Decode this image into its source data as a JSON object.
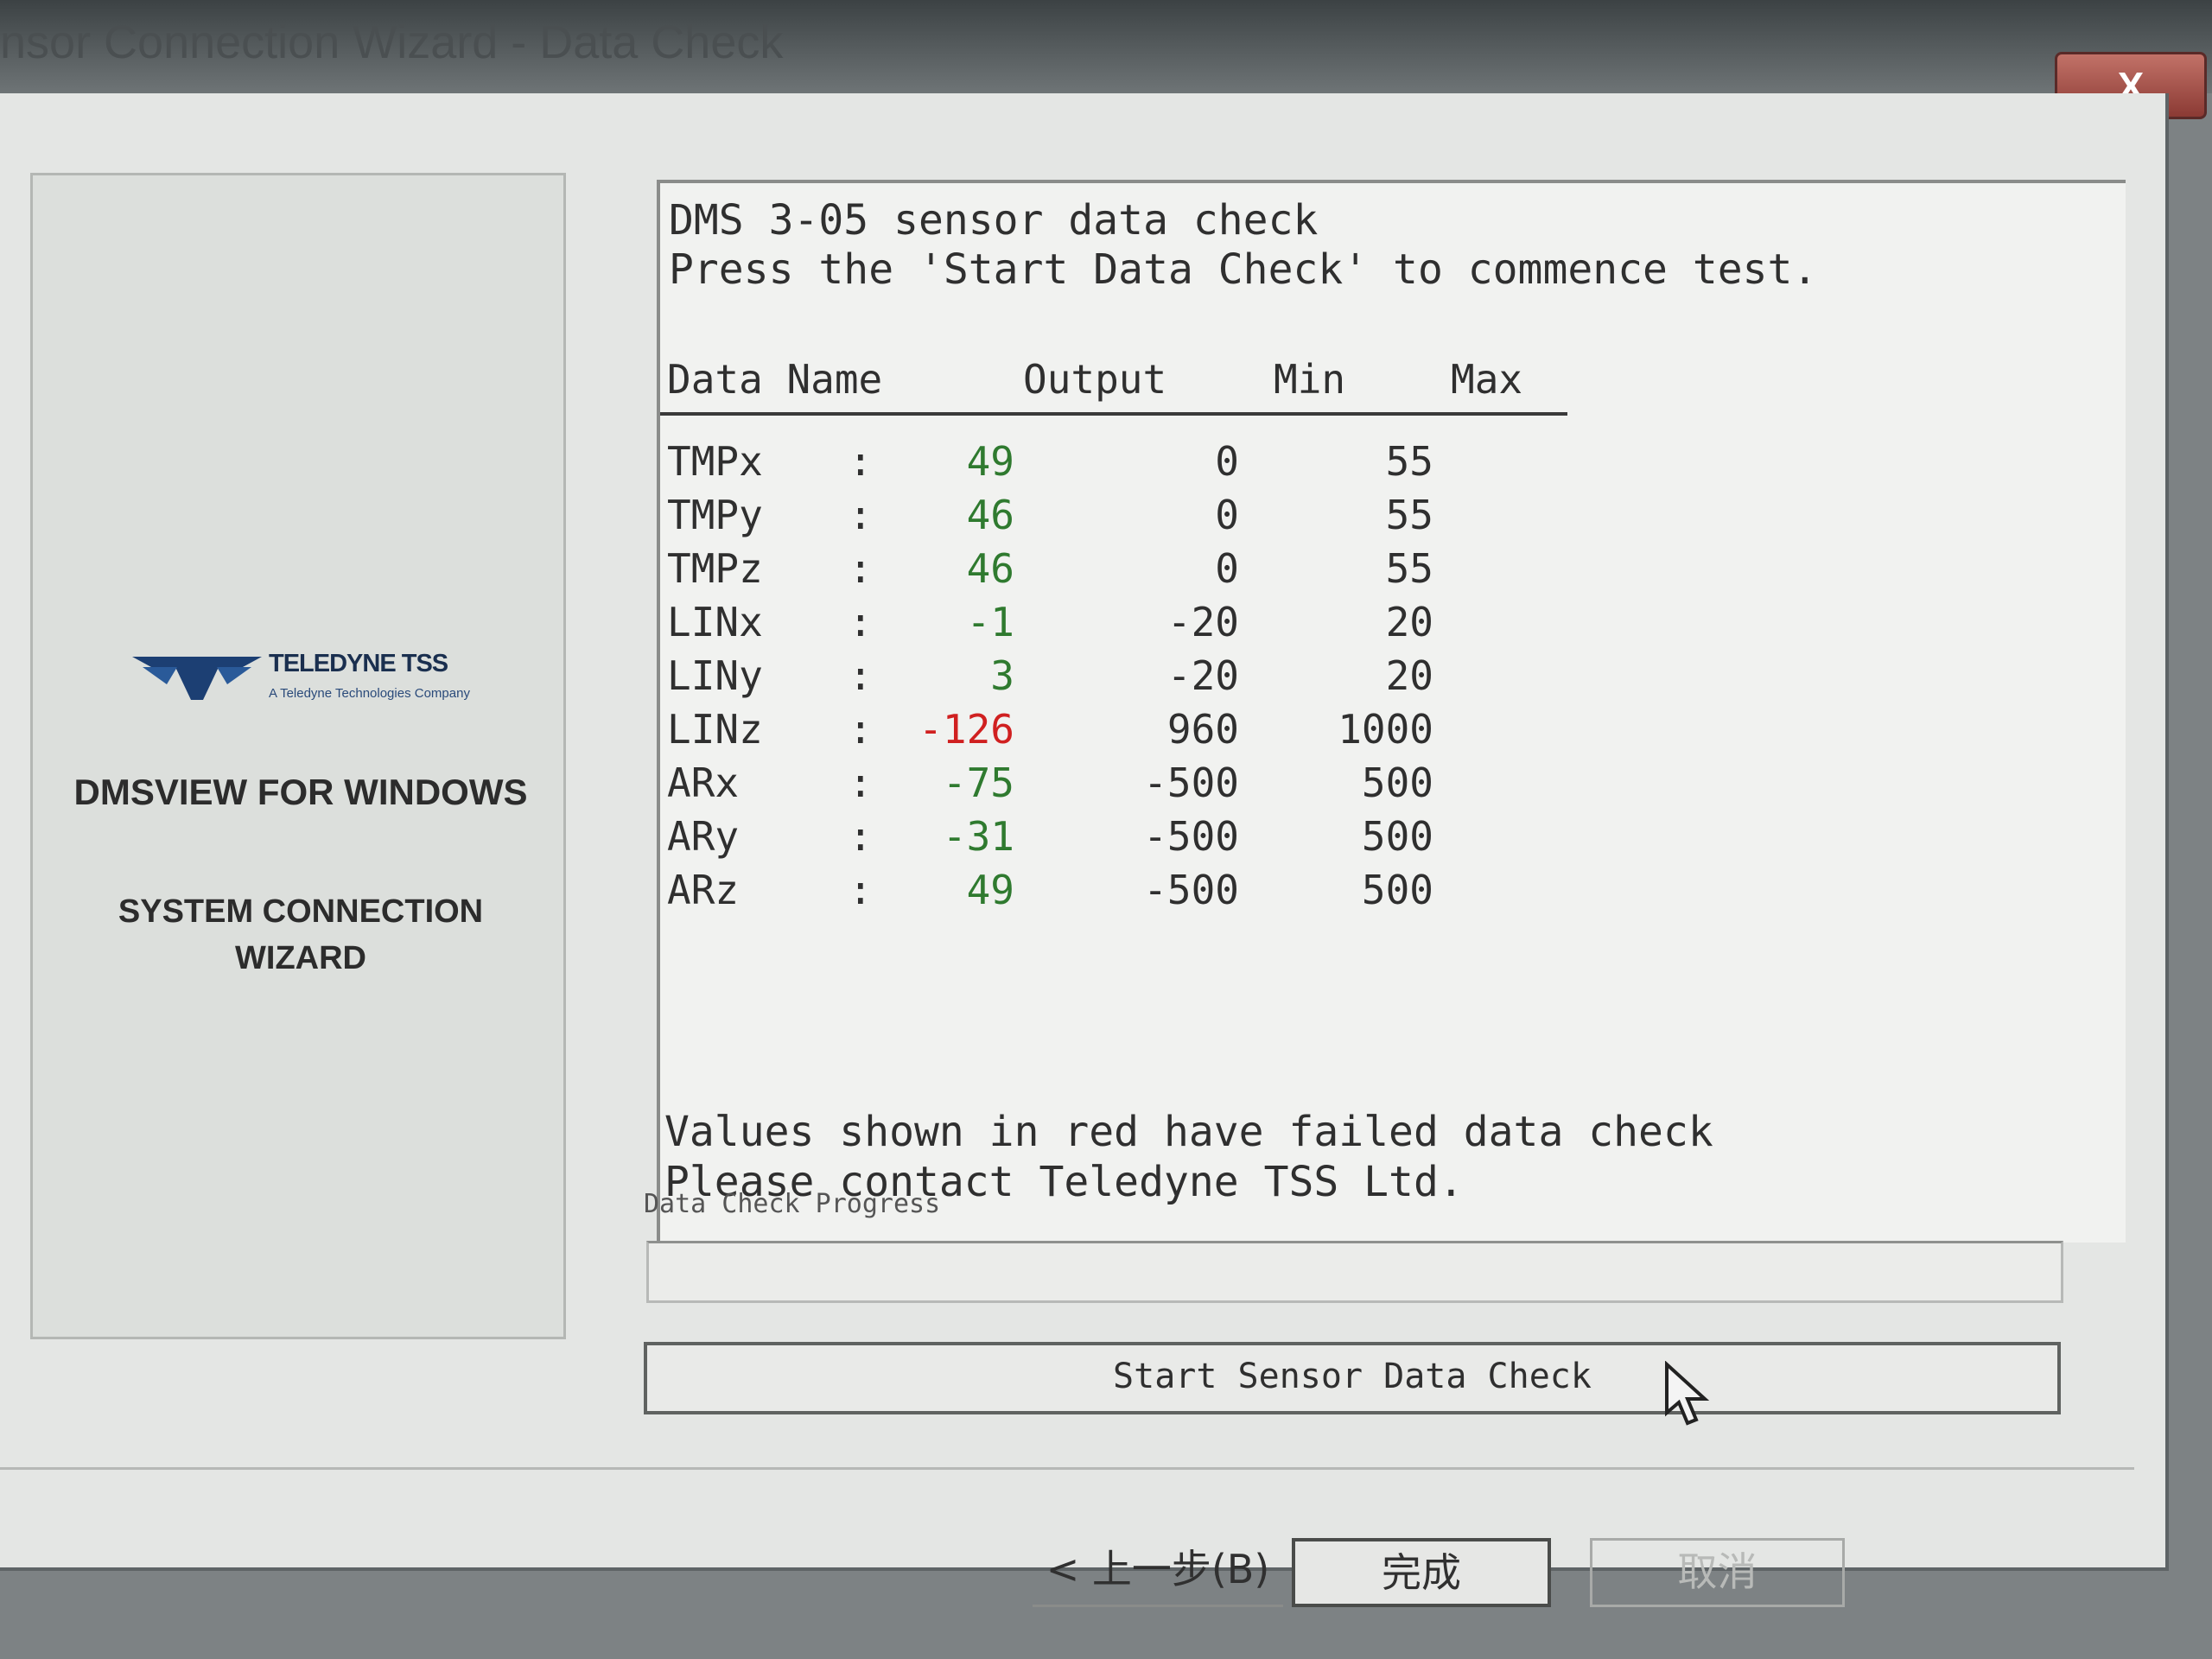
{
  "window": {
    "title": "nsor Connection Wizard - Data Check",
    "close_label": "X"
  },
  "left_panel": {
    "logo_text": "TELEDYNE TSS",
    "logo_subtext": "A Teledyne Technologies Company",
    "heading": "DMSVIEW FOR WINDOWS",
    "subheading_line1": "SYSTEM CONNECTION",
    "subheading_line2": "WIZARD"
  },
  "data_check": {
    "title": "DMS 3-05 sensor data check",
    "instruction": "Press the 'Start Data Check' to commence test.",
    "columns": {
      "name": "Data Name",
      "output": "Output",
      "min": "Min",
      "max": "Max"
    },
    "rows": [
      {
        "name": "TMPx",
        "sep": ":",
        "output": "49",
        "min": "0",
        "max": "55",
        "status": "ok"
      },
      {
        "name": "TMPy",
        "sep": ":",
        "output": "46",
        "min": "0",
        "max": "55",
        "status": "ok"
      },
      {
        "name": "TMPz",
        "sep": ":",
        "output": "46",
        "min": "0",
        "max": "55",
        "status": "ok"
      },
      {
        "name": "LINx",
        "sep": ":",
        "output": "-1",
        "min": "-20",
        "max": "20",
        "status": "ok"
      },
      {
        "name": "LINy",
        "sep": ":",
        "output": "3",
        "min": "-20",
        "max": "20",
        "status": "ok"
      },
      {
        "name": "LINz",
        "sep": ":",
        "output": "-126",
        "min": "960",
        "max": "1000",
        "status": "fail"
      },
      {
        "name": "ARx",
        "sep": ":",
        "output": "-75",
        "min": "-500",
        "max": "500",
        "status": "ok"
      },
      {
        "name": "ARy",
        "sep": ":",
        "output": "-31",
        "min": "-500",
        "max": "500",
        "status": "ok"
      },
      {
        "name": "ARz",
        "sep": ":",
        "output": "49",
        "min": "-500",
        "max": "500",
        "status": "ok"
      }
    ],
    "fail_message": "Values shown in red have failed data check",
    "contact_message": "Please contact Teledyne TSS Ltd."
  },
  "progress": {
    "label": "Data Check Progress",
    "value": 0
  },
  "buttons": {
    "start": "Start Sensor Data Check",
    "back": "< 上一步(B)",
    "finish": "完成",
    "cancel": "取消"
  },
  "colors": {
    "ok": "#2f7a2f",
    "fail": "#d02020"
  }
}
